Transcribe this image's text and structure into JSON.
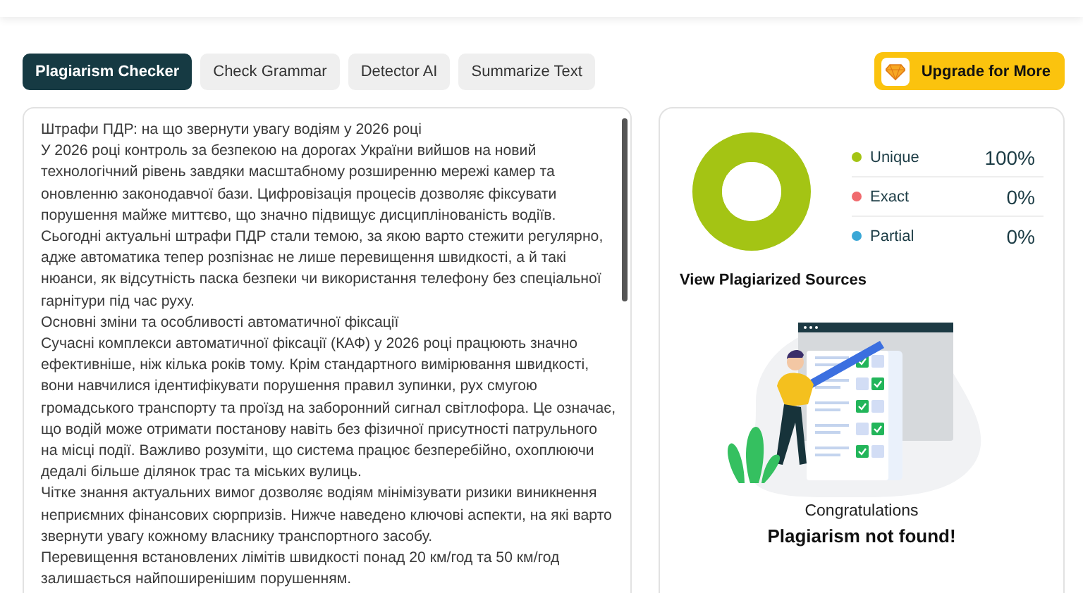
{
  "tabs": [
    {
      "label": "Plagiarism Checker",
      "selected": true
    },
    {
      "label": "Check Grammar",
      "selected": false
    },
    {
      "label": "Detector AI",
      "selected": false
    },
    {
      "label": "Summarize Text",
      "selected": false
    }
  ],
  "upgrade_button": {
    "label": "Upgrade for More"
  },
  "editor": {
    "paragraphs": [
      "Штрафи ПДР: на що звернути увагу водіям у 2026 році",
      "У 2026 році контроль за безпекою на дорогах України вийшов на новий технологічний рівень завдяки масштабному розширенню мережі камер та оновленню законодавчої бази. Цифровізація процесів дозволяє фіксувати порушення майже миттєво, що значно підвищує дисциплінованість водіїв.",
      "Сьогодні актуальні штрафи ПДР стали темою, за якою варто стежити регулярно, адже автоматика тепер розпізнає не лише перевищення швидкості, а й такі нюанси, як відсутність паска безпеки чи використання телефону без спеціальної гарнітури під час руху.",
      "Основні зміни та особливості автоматичної фіксації",
      "Сучасні комплекси автоматичної фіксації (КАФ) у 2026 році працюють значно ефективніше, ніж кілька років тому. Крім стандартного вимірювання швидкості, вони навчилися ідентифікувати порушення правил зупинки, рух смугою громадського транспорту та проїзд на заборонний сигнал світлофора. Це означає, що водій може отримати постанову навіть без фізичної присутності патрульного на місці події. Важливо розуміти, що система працює безперебійно, охоплюючи дедалі більше ділянок трас та міських вулиць.",
      "Чітке знання актуальних вимог дозволяє водіям мінімізувати ризики виникнення неприємних фінансових сюрпризів. Нижче наведено ключові аспекти, на які варто звернути увагу кожному власнику транспортного засобу.",
      "Перевищення встановлених лімітів швидкості понад 20 км/год та 50 км/год залишається найпоширенішим порушенням."
    ]
  },
  "results": {
    "legend": [
      {
        "label": "Unique",
        "value": "100%",
        "color": "#a4c414"
      },
      {
        "label": "Exact",
        "value": "0%",
        "color": "#f06a6e"
      },
      {
        "label": "Partial",
        "value": "0%",
        "color": "#3aa7d6"
      }
    ],
    "chart_data": {
      "type": "donut",
      "values": [
        100,
        0,
        0
      ]
    },
    "sources_heading": "View Plagiarized Sources",
    "congrats": "Congratulations",
    "message": "Plagiarism not found!"
  }
}
